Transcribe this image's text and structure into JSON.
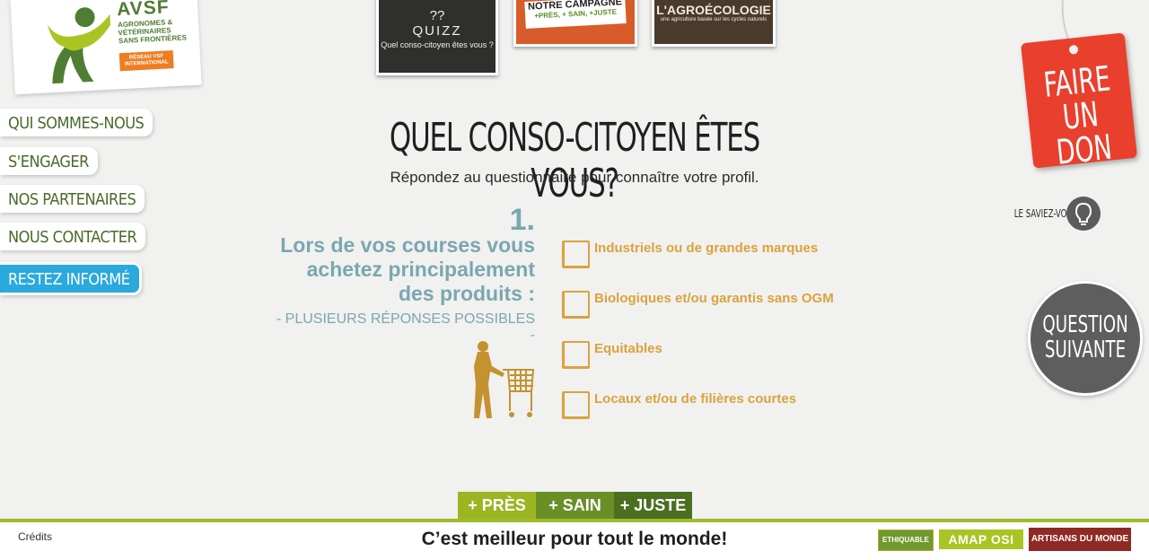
{
  "logo": {
    "title": "AVSF",
    "subtitle": "AGRONOMES & VÉTÉRINAIRES SANS FRONTIÈRES",
    "badge": "RÉSEAU VSF INTERNATIONAL"
  },
  "nav": {
    "items": [
      {
        "label": "QUI SOMMES-NOUS"
      },
      {
        "label": "S'ENGAGER"
      },
      {
        "label": "NOS PARTENAIRES"
      },
      {
        "label": "NOUS CONTACTER"
      },
      {
        "label": "RESTEZ INFORMÉ"
      }
    ]
  },
  "thumbs": {
    "quiz": {
      "line1": "??",
      "line2": "QUIZZ",
      "line3": "Quel conso-citoyen êtes vous ?"
    },
    "campaign": {
      "line1": "NOTRE CAMPAGNE",
      "line2": "+PRÈS, + SAIN, +JUSTE"
    },
    "agro": {
      "line1": "L'AGROÉCOLOGIE",
      "line2": "une agriculture basée sur les cycles naturels"
    }
  },
  "main": {
    "title": "QUEL CONSO-CITOYEN ÊTES VOUS?",
    "subtitle": "Répondez au questionnaire pour connaître votre profil."
  },
  "question": {
    "number": "1.",
    "text": "Lors de vos courses vous achetez principalement des produits :",
    "hint": "- PLUSIEURS RÉPONSES POSSIBLES -",
    "answers": [
      {
        "label": "Industriels ou de grandes marques"
      },
      {
        "label": "Biologiques et/ou garantis sans OGM"
      },
      {
        "label": "Equitables"
      },
      {
        "label": "Locaux et/ou de filières courtes"
      }
    ]
  },
  "right": {
    "don_line1": "FAIRE",
    "don_line2": "UN DON",
    "saviez": "LE SAVIEZ-VOUS ?",
    "next_line1": "QUESTION",
    "next_line2": "SUIVANTE"
  },
  "tags": [
    {
      "label": "+ PRÈS",
      "color": "#9bb523"
    },
    {
      "label": "+ SAIN",
      "color": "#6a8f27"
    },
    {
      "label": "+ JUSTE",
      "color": "#4c6e21"
    }
  ],
  "footer": {
    "credits": "Crédits",
    "slogan": "C’est meilleur pour tout le monde!",
    "partners": [
      "ETHIQUABLE",
      "AMAP OSI",
      "ARTISANS DU MONDE"
    ]
  },
  "colors": {
    "accent_green": "#9dbb2a",
    "question_teal": "#7aa7b0",
    "answer_gold": "#d9a33e",
    "don_red": "#e8402d",
    "nav_blue": "#2aa9dd"
  }
}
